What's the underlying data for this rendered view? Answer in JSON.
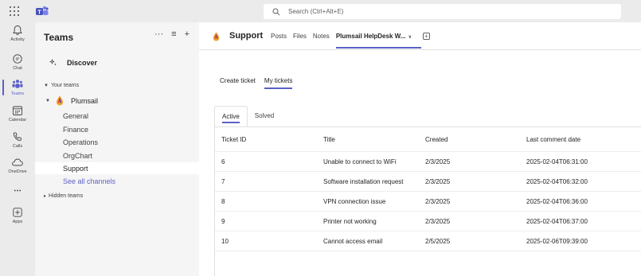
{
  "topbar": {
    "search_placeholder": "Search (Ctrl+Alt+E)"
  },
  "rail": {
    "items": [
      {
        "label": "Activity",
        "icon": "bell-icon"
      },
      {
        "label": "Chat",
        "icon": "chat-icon"
      },
      {
        "label": "Teams",
        "icon": "teams-icon"
      },
      {
        "label": "Calendar",
        "icon": "calendar-icon"
      },
      {
        "label": "Calls",
        "icon": "phone-icon"
      },
      {
        "label": "OneDrive",
        "icon": "cloud-icon"
      },
      {
        "label": "",
        "icon": "more-icon"
      },
      {
        "label": "Apps",
        "icon": "add-app-icon"
      }
    ]
  },
  "panel": {
    "title": "Teams",
    "discover": "Discover",
    "your_teams": "Your teams",
    "team_name": "Plumsail",
    "channels": [
      "General",
      "Finance",
      "Operations",
      "OrgChart",
      "Support"
    ],
    "see_all": "See all channels",
    "hidden_teams": "Hidden teams"
  },
  "header": {
    "channel_name": "Support",
    "tabs": [
      "Posts",
      "Files",
      "Notes",
      "Plumsail HelpDesk W..."
    ]
  },
  "subtabs": [
    "Create ticket",
    "My tickets"
  ],
  "card_tabs": [
    "Active",
    "Solved"
  ],
  "table": {
    "headers": [
      "Ticket ID",
      "Title",
      "Created",
      "Last comment date"
    ],
    "rows": [
      [
        "6",
        "Unable to connect to WiFi",
        "2/3/2025",
        "2025-02-04T06:31:00"
      ],
      [
        "7",
        "Software installation request",
        "2/3/2025",
        "2025-02-04T06:32:00"
      ],
      [
        "8",
        "VPN connection issue",
        "2/3/2025",
        "2025-02-04T06:36:00"
      ],
      [
        "9",
        "Printer not working",
        "2/3/2025",
        "2025-02-04T06:37:00"
      ],
      [
        "10",
        "Cannot access email",
        "2/5/2025",
        "2025-02-06T09:39:00"
      ]
    ]
  },
  "colors": {
    "accent": "#5b5fc7",
    "rail_bg": "#ebebeb",
    "panel_bg": "#f5f5f5"
  }
}
